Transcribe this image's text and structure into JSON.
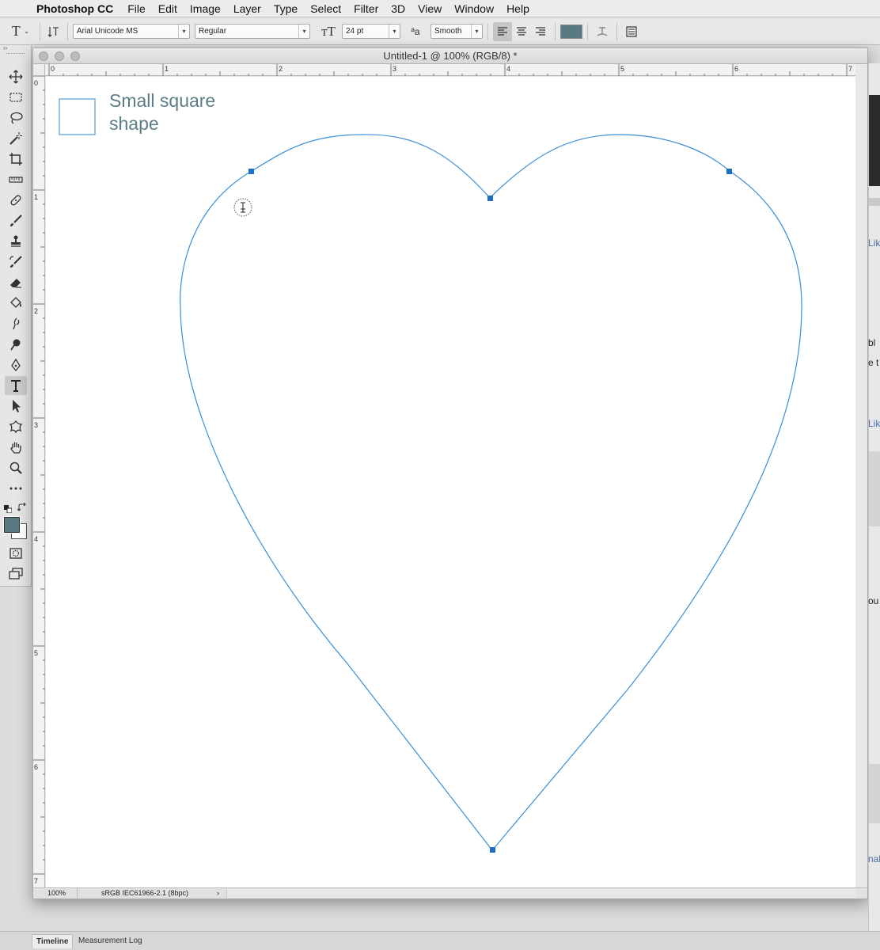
{
  "menubar": {
    "app_name": "Photoshop CC",
    "items": [
      "File",
      "Edit",
      "Image",
      "Layer",
      "Type",
      "Select",
      "Filter",
      "3D",
      "View",
      "Window",
      "Help"
    ]
  },
  "options_bar": {
    "font_family": "Arial Unicode MS",
    "font_style": "Regular",
    "font_size": "24 pt",
    "anti_alias": "Smooth",
    "text_color": "#5a7a82",
    "alignment": "left"
  },
  "tools": [
    {
      "name": "move-tool",
      "icon": "move-icon"
    },
    {
      "name": "marquee-tool",
      "icon": "marquee-icon"
    },
    {
      "name": "lasso-tool",
      "icon": "lasso-icon"
    },
    {
      "name": "magic-wand-tool",
      "icon": "magic-wand-icon"
    },
    {
      "name": "crop-tool",
      "icon": "crop-icon"
    },
    {
      "name": "ruler-tool",
      "icon": "ruler-icon"
    },
    {
      "name": "healing-tool",
      "icon": "bandage-icon"
    },
    {
      "name": "brush-tool",
      "icon": "brush-icon"
    },
    {
      "name": "stamp-tool",
      "icon": "stamp-icon"
    },
    {
      "name": "history-brush-tool",
      "icon": "history-brush-icon"
    },
    {
      "name": "eraser-tool",
      "icon": "eraser-icon"
    },
    {
      "name": "paint-bucket-tool",
      "icon": "bucket-icon"
    },
    {
      "name": "smudge-tool",
      "icon": "smudge-icon"
    },
    {
      "name": "dodge-tool",
      "icon": "dodge-icon"
    },
    {
      "name": "pen-tool",
      "icon": "pen-icon"
    },
    {
      "name": "type-tool",
      "icon": "type-icon",
      "active": true
    },
    {
      "name": "path-selection-tool",
      "icon": "arrow-icon"
    },
    {
      "name": "custom-shape-tool",
      "icon": "shape-icon"
    },
    {
      "name": "hand-tool",
      "icon": "hand-icon"
    },
    {
      "name": "zoom-tool",
      "icon": "zoom-icon"
    },
    {
      "name": "more-tools",
      "icon": "ellipsis-icon"
    }
  ],
  "colors": {
    "foreground": "#5a7a82",
    "background": "#ffffff",
    "path": "#3a8ed6",
    "anchor": "#1e6fc4"
  },
  "document": {
    "title": "Untitled-1 @ 100% (RGB/8) *",
    "zoom": "100%",
    "color_profile": "sRGB IEC61966-2.1 (8bpc)",
    "more_arrow": "›",
    "ruler_h_labels": [
      "0",
      "1",
      "2",
      "3",
      "4",
      "5",
      "6",
      "7"
    ],
    "ruler_v_labels": [
      "0",
      "1",
      "2",
      "3",
      "4",
      "5",
      "6",
      "7"
    ],
    "canvas_label": {
      "line1": "Small square",
      "line2": "shape"
    }
  },
  "right_panel": {
    "fragments": [
      "Lik",
      "bl",
      "e t",
      "Lik",
      "ou",
      "nal"
    ]
  },
  "bottom_tabs": [
    "Timeline",
    "Measurement Log"
  ]
}
